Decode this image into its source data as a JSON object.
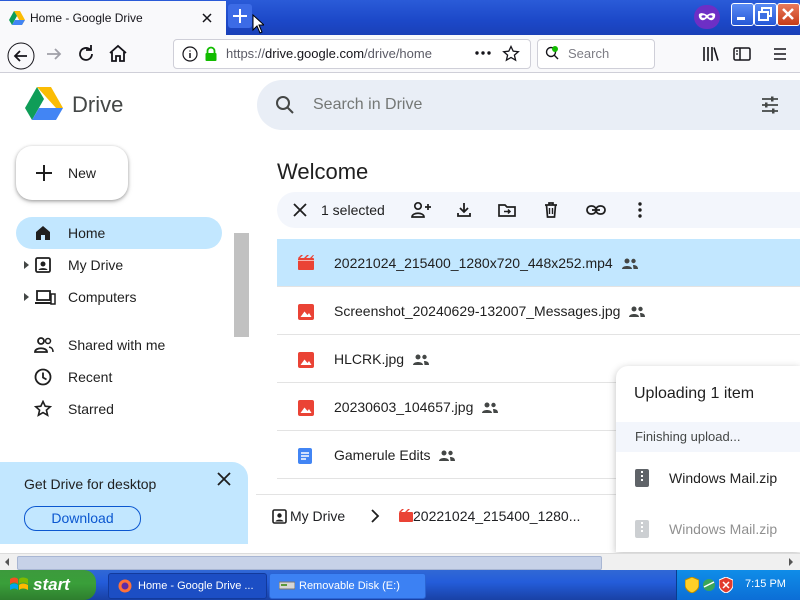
{
  "browser": {
    "tab_title": "Home - Google Drive",
    "url_prefix": "https://",
    "url_host": "drive.google.com",
    "url_path": "/drive/home",
    "search_placeholder": "Search"
  },
  "drive": {
    "app_name": "Drive",
    "search_placeholder": "Search in Drive",
    "new_label": "New",
    "nav": [
      {
        "label": "Home",
        "icon": "home-icon",
        "active": true
      },
      {
        "label": "My Drive",
        "icon": "my-drive-icon"
      },
      {
        "label": "Computers",
        "icon": "computers-icon"
      },
      {
        "label": "Shared with me",
        "icon": "shared-icon"
      },
      {
        "label": "Recent",
        "icon": "clock-icon"
      },
      {
        "label": "Starred",
        "icon": "star-icon"
      }
    ],
    "promo": {
      "title": "Get Drive for desktop",
      "button": "Download"
    },
    "main": {
      "title": "Welcome",
      "selection_count": "1 selected",
      "files": [
        {
          "name": "20221024_215400_1280x720_448x252.mp4",
          "type": "video",
          "shared": true,
          "selected": true
        },
        {
          "name": "Screenshot_20240629-132007_Messages.jpg",
          "type": "image",
          "shared": true
        },
        {
          "name": "HLCRK.jpg",
          "type": "image",
          "shared": true
        },
        {
          "name": "20230603_104657.jpg",
          "type": "image",
          "shared": true
        },
        {
          "name": "Gamerule Edits",
          "type": "doc",
          "shared": true
        }
      ],
      "breadcrumb": {
        "root": "My Drive",
        "file": "20221024_215400_1280..."
      }
    },
    "upload": {
      "title": "Uploading 1 item",
      "status": "Finishing upload...",
      "items": [
        "Windows Mail.zip",
        "Windows Mail.zip"
      ]
    }
  },
  "taskbar": {
    "start": "start",
    "tasks": [
      "Home - Google Drive ...",
      "Removable Disk (E:)"
    ],
    "clock": "7:15 PM"
  },
  "colors": {
    "accent": "#0b57d0",
    "selected": "#c2e7ff",
    "xp_blue": "#245dda",
    "xp_green": "#3a9f3a"
  }
}
